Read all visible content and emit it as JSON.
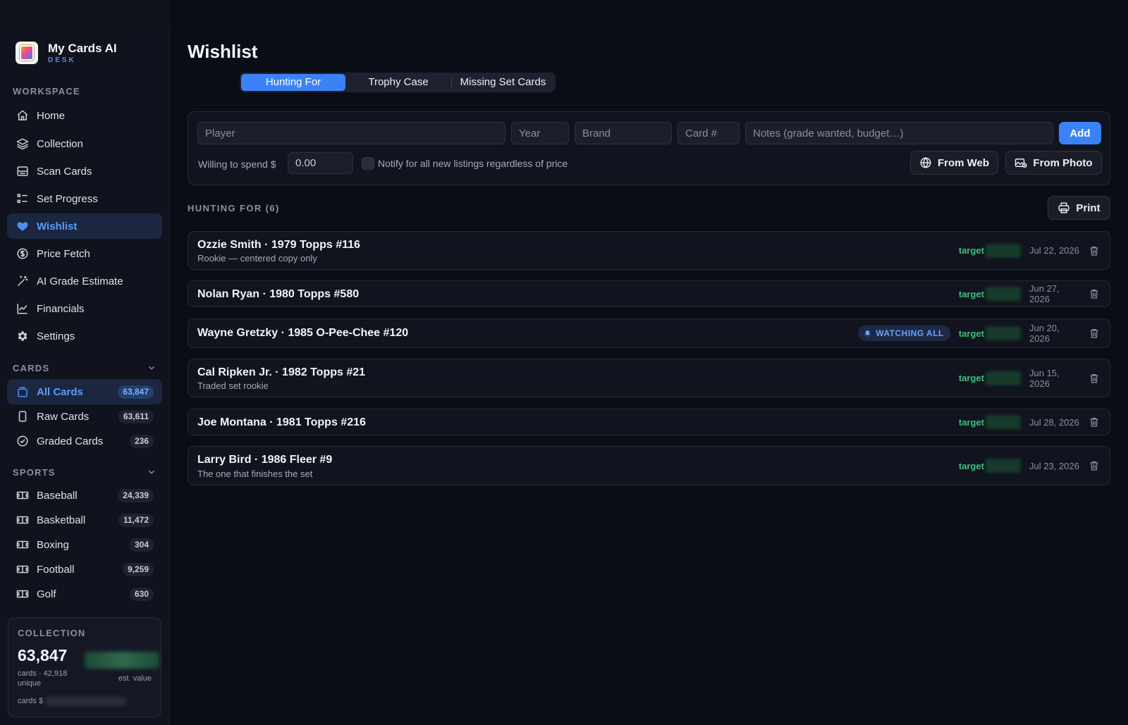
{
  "app": {
    "name": "My Cards AI",
    "edition": "DESK"
  },
  "sidebar": {
    "workspace_label": "WORKSPACE",
    "workspace_items": [
      {
        "label": "Home",
        "icon": "home-icon"
      },
      {
        "label": "Collection",
        "icon": "layers-icon"
      },
      {
        "label": "Scan Cards",
        "icon": "scanner-icon"
      },
      {
        "label": "Set Progress",
        "icon": "checklist-icon"
      },
      {
        "label": "Wishlist",
        "icon": "heart-icon",
        "active": true
      },
      {
        "label": "Price Fetch",
        "icon": "dollar-circle-icon"
      },
      {
        "label": "AI Grade Estimate",
        "icon": "magic-wand-icon"
      },
      {
        "label": "Financials",
        "icon": "trend-chart-icon"
      },
      {
        "label": "Settings",
        "icon": "gear-icon"
      }
    ],
    "cards_label": "CARDS",
    "cards_items": [
      {
        "label": "All Cards",
        "count": "63,847",
        "icon": "card-stack-icon",
        "active": true
      },
      {
        "label": "Raw Cards",
        "count": "63,611",
        "icon": "card-icon"
      },
      {
        "label": "Graded Cards",
        "count": "236",
        "icon": "badge-check-icon"
      }
    ],
    "sports_label": "SPORTS",
    "sports_items": [
      {
        "label": "Baseball",
        "count": "24,339",
        "icon": "field-icon"
      },
      {
        "label": "Basketball",
        "count": "11,472",
        "icon": "field-icon"
      },
      {
        "label": "Boxing",
        "count": "304",
        "icon": "field-icon"
      },
      {
        "label": "Football",
        "count": "9,259",
        "icon": "field-icon"
      },
      {
        "label": "Golf",
        "count": "630",
        "icon": "field-icon"
      }
    ],
    "collection_card": {
      "label": "COLLECTION",
      "count": "63,847",
      "unique": "cards · 42,918 unique",
      "est_value_label": "est. value",
      "cards_prefix": "cards $"
    }
  },
  "main": {
    "title": "Wishlist",
    "tabs": [
      "Hunting For",
      "Trophy Case",
      "Missing Set Cards"
    ],
    "active_tab": 0,
    "form": {
      "player_placeholder": "Player",
      "year_placeholder": "Year",
      "brand_placeholder": "Brand",
      "card_placeholder": "Card #",
      "notes_placeholder": "Notes (grade wanted, budget…)",
      "add_label": "Add",
      "spend_label": "Willing to spend $",
      "spend_value": "0.00",
      "notify_label": "Notify for all new listings regardless of price",
      "notify_checked": false,
      "from_web_label": "From Web",
      "from_photo_label": "From Photo"
    },
    "list_header": "HUNTING FOR (6)",
    "print_label": "Print",
    "target_label": "target",
    "watching_label": "WATCHING ALL",
    "items": [
      {
        "title": "Ozzie Smith · 1979 Topps #116",
        "note": "Rookie — centered copy only",
        "date": "Jul 22, 2026",
        "watching": false
      },
      {
        "title": "Nolan Ryan · 1980 Topps #580",
        "note": "",
        "date": "Jun 27, 2026",
        "watching": false
      },
      {
        "title": "Wayne Gretzky · 1985 O-Pee-Chee #120",
        "note": "",
        "date": "Jun 20, 2026",
        "watching": true
      },
      {
        "title": "Cal Ripken Jr. · 1982 Topps #21",
        "note": "Traded set rookie",
        "date": "Jun 15, 2026",
        "watching": false
      },
      {
        "title": "Joe Montana · 1981 Topps #216",
        "note": "",
        "date": "Jul 28, 2026",
        "watching": false
      },
      {
        "title": "Larry Bird · 1986 Fleer #9",
        "note": "The one that finishes the set",
        "date": "Jul 23, 2026",
        "watching": false
      }
    ]
  },
  "colors": {
    "accent": "#3b82f6",
    "target": "#3fbf7f",
    "background": "#0b0d16",
    "sidebar": "#10131d"
  }
}
